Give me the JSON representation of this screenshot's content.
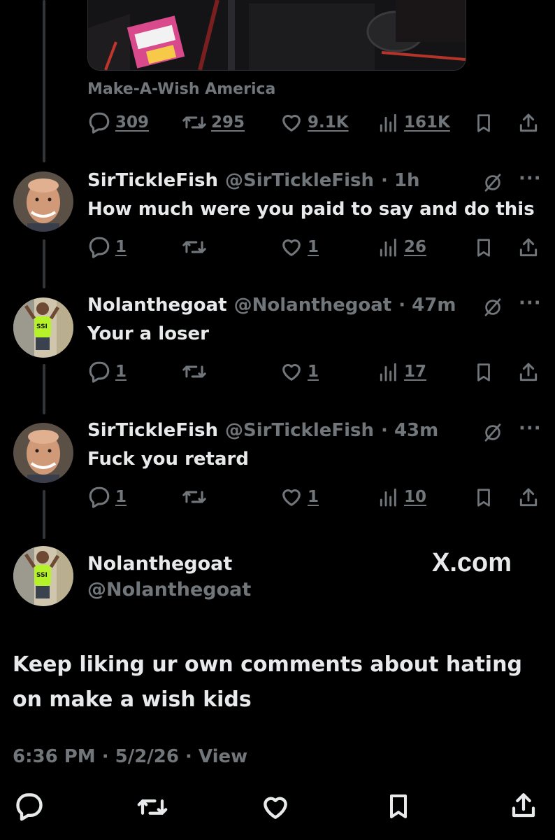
{
  "quoted": {
    "source_label": "Make-A-Wish America",
    "stats": {
      "replies": "309",
      "reposts": "295",
      "likes": "9.1K",
      "views": "161K"
    }
  },
  "replies": [
    {
      "name": "SirTickleFish",
      "handle": "@SirTickleFish",
      "time": "· 1h",
      "text": "How much were you paid to say and do this",
      "stats": {
        "replies": "1",
        "reposts": "",
        "likes": "1",
        "views": "26"
      },
      "avatar": "bald-man-avatar"
    },
    {
      "name": "Nolanthegoat",
      "handle": "@Nolanthegoat",
      "time": "· 47m",
      "text": "Your a loser",
      "stats": {
        "replies": "1",
        "reposts": "",
        "likes": "1",
        "views": "17"
      },
      "avatar": "kid-avatar"
    },
    {
      "name": "SirTickleFish",
      "handle": "@SirTickleFish",
      "time": "· 43m",
      "text": "Fuck you retard",
      "stats": {
        "replies": "1",
        "reposts": "",
        "likes": "1",
        "views": "10"
      },
      "avatar": "bald-man-avatar"
    }
  ],
  "main_post": {
    "name": "Nolanthegoat",
    "handle": "@Nolanthegoat",
    "watermark": "X.com",
    "text": "Keep liking ur own comments about hating on make a wish kids",
    "timestamp": "6:36 PM · 5/2/26 · View"
  },
  "more_label": "···",
  "colors": {
    "background": "#000000",
    "text": "#e7e9ea",
    "muted": "#71767b",
    "thread_line": "#333639"
  }
}
